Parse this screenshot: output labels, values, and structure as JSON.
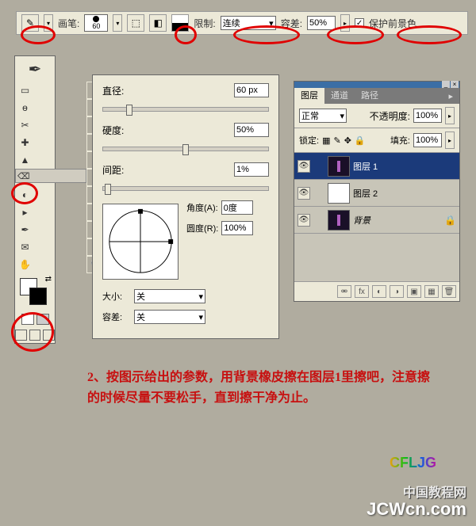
{
  "topbar": {
    "brush_label": "画笔:",
    "brush_size": "60",
    "limit_label": "限制:",
    "limit_value": "连续",
    "tolerance_label": "容差:",
    "tolerance_value": "50%",
    "protect_fg": "保护前景色",
    "protect_checked": "✓"
  },
  "brush_panel": {
    "diameter_label": "直径:",
    "diameter_value": "60 px",
    "hardness_label": "硬度:",
    "hardness_value": "50%",
    "spacing_label": "间距:",
    "spacing_value": "1%",
    "angle_label": "角度(A):",
    "angle_value": "0度",
    "roundness_label": "圆度(R):",
    "roundness_value": "100%",
    "size_label": "大小:",
    "size_value": "关",
    "tol_label": "容差:",
    "tol_value": "关"
  },
  "layers": {
    "tab1": "图层",
    "tab2": "通道",
    "tab3": "路径",
    "mode": "正常",
    "opacity_label": "不透明度:",
    "opacity_value": "100%",
    "lock_label": "锁定:",
    "fill_label": "填充:",
    "fill_value": "100%",
    "items": [
      {
        "name": "图层 1"
      },
      {
        "name": "图层 2"
      },
      {
        "name": "背景"
      }
    ]
  },
  "instruction": "2、按图示给出的参数，用背景橡皮擦在图层1里擦吧，注意擦的时候尽量不要松手，直到擦干净为止。",
  "logo": "CFLJG",
  "watermark1": "中国教程网",
  "watermark2": "JCWcn.com"
}
